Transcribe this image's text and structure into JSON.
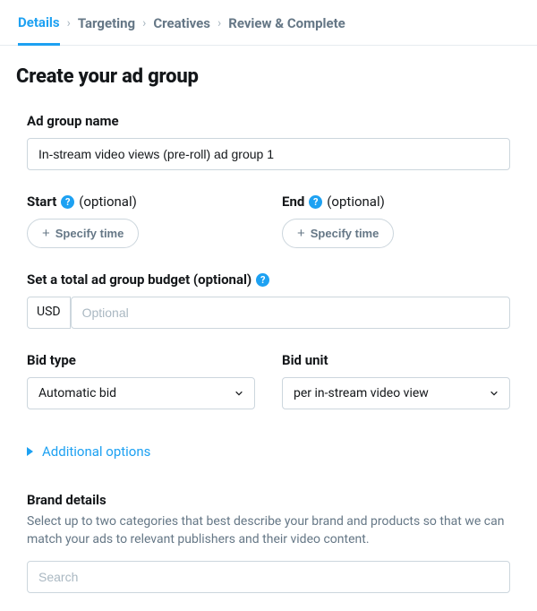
{
  "tabs": {
    "details": "Details",
    "targeting": "Targeting",
    "creatives": "Creatives",
    "review": "Review & Complete"
  },
  "page_title": "Create your ad group",
  "ad_group_name": {
    "label": "Ad group name",
    "value": "In-stream video views (pre-roll) ad group 1"
  },
  "start": {
    "label": "Start",
    "optional": "(optional)",
    "button": "Specify time"
  },
  "end": {
    "label": "End",
    "optional": "(optional)",
    "button": "Specify time"
  },
  "budget": {
    "label": "Set a total ad group budget (optional)",
    "currency": "USD",
    "placeholder": "Optional"
  },
  "bid_type": {
    "label": "Bid type",
    "value": "Automatic bid"
  },
  "bid_unit": {
    "label": "Bid unit",
    "value": "per in-stream video view"
  },
  "additional_options": "Additional options",
  "brand": {
    "heading": "Brand details",
    "description": "Select up to two categories that best describe your brand and products so that we can match your ads to relevant publishers and their video content.",
    "search_placeholder": "Search"
  }
}
